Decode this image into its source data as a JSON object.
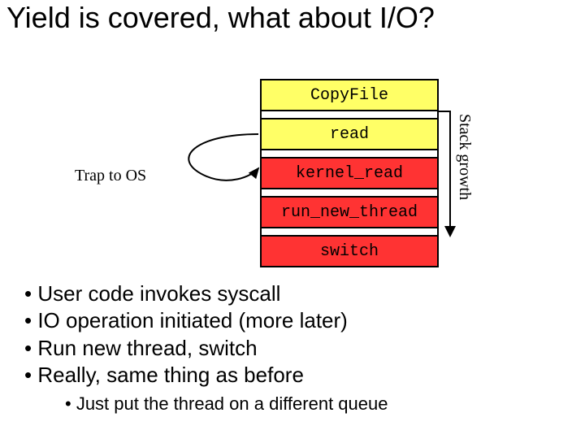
{
  "title": "Yield is covered, what about I/O?",
  "trap_label": "Trap to OS",
  "stack_growth_label": "Stack growth",
  "frames": {
    "copyfile": "CopyFile",
    "read": "read",
    "kernel_read": "kernel_read",
    "run_new_thread": "run_new_thread",
    "switch": "switch"
  },
  "bullets": {
    "b1": "• User code invokes syscall",
    "b2": "• IO operation initiated (more later)",
    "b3": "• Run new thread, switch",
    "b4": "• Really, same thing as before",
    "sub": "• Just put the thread on a different queue"
  }
}
